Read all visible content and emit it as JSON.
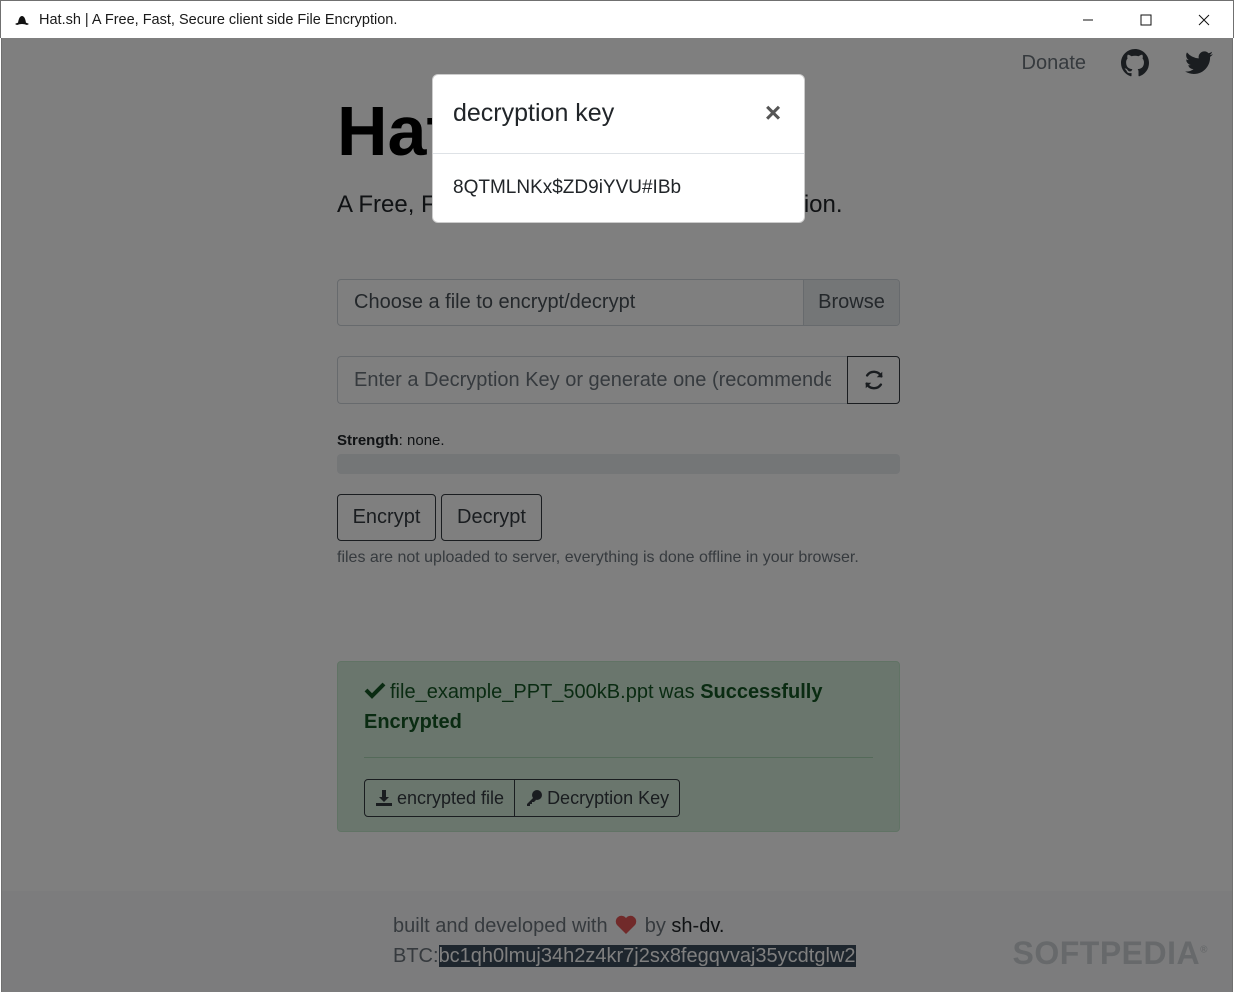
{
  "window": {
    "title": "Hat.sh | A Free, Fast, Secure client side File Encryption.",
    "icon": "hat-icon"
  },
  "nav": {
    "donate": "Donate",
    "github_icon": "github-icon",
    "twitter_icon": "twitter-icon"
  },
  "hero": {
    "brand": "Hat.sh",
    "lead": "A Free, Fast, Secure client side File Encryption."
  },
  "form": {
    "file_placeholder": "Choose a file to encrypt/decrypt",
    "browse_label": "Browse",
    "key_placeholder": "Enter a Decryption Key or generate one (recommended)",
    "strength_label": "Strength",
    "strength_value": ": none.",
    "strength_fraction": 0,
    "encrypt_label": "Encrypt",
    "decrypt_label": "Decrypt",
    "hint": "files are not uploaded to server, everything is done offline in your browser."
  },
  "alert": {
    "filename_text": "file_example_PPT_500kB.ppt was ",
    "status_text": "Successfully Encrypted",
    "download_label": "encrypted file",
    "key_label": "Decryption Key"
  },
  "footer": {
    "built_prefix": "built and developed with",
    "by": "by",
    "author": "sh-dv.",
    "btc_label": "BTC:",
    "btc_address": "bc1qh0lmuj34h2z4kr7j2sx8fegqvvaj35ycdtglw2",
    "watermark": "SOFTPEDIA"
  },
  "modal": {
    "title": "decryption key",
    "close": "×",
    "key_value": "8QTMLNKx$ZD9iYVU#IBb"
  },
  "colors": {
    "success_bg": "#d4edda",
    "success_text": "#155724",
    "heart": "#e25555",
    "backdrop": "rgba(0,0,0,0.5)"
  }
}
